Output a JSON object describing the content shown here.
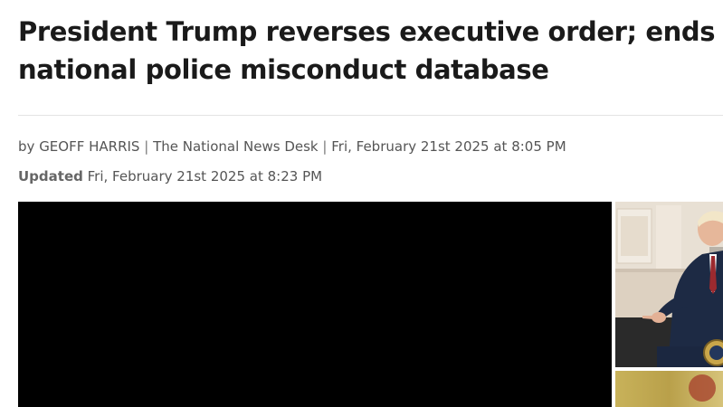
{
  "article": {
    "headline": "President Trump reverses executive order; ends national police misconduct database",
    "byline": {
      "prefix": "by",
      "author": "GEOFF HARRIS",
      "separator": "|",
      "outlet": "The National News Desk",
      "date": "Fri, February 21st 2025 at 8:05 PM"
    },
    "updated": {
      "label": "Updated",
      "date": "Fri, February 21st 2025 at 8:23 PM"
    }
  },
  "colors": {
    "headline": "#1a1a1a",
    "byline": "#555555",
    "video_background": "#000000",
    "divider": "#e3e3e3"
  }
}
